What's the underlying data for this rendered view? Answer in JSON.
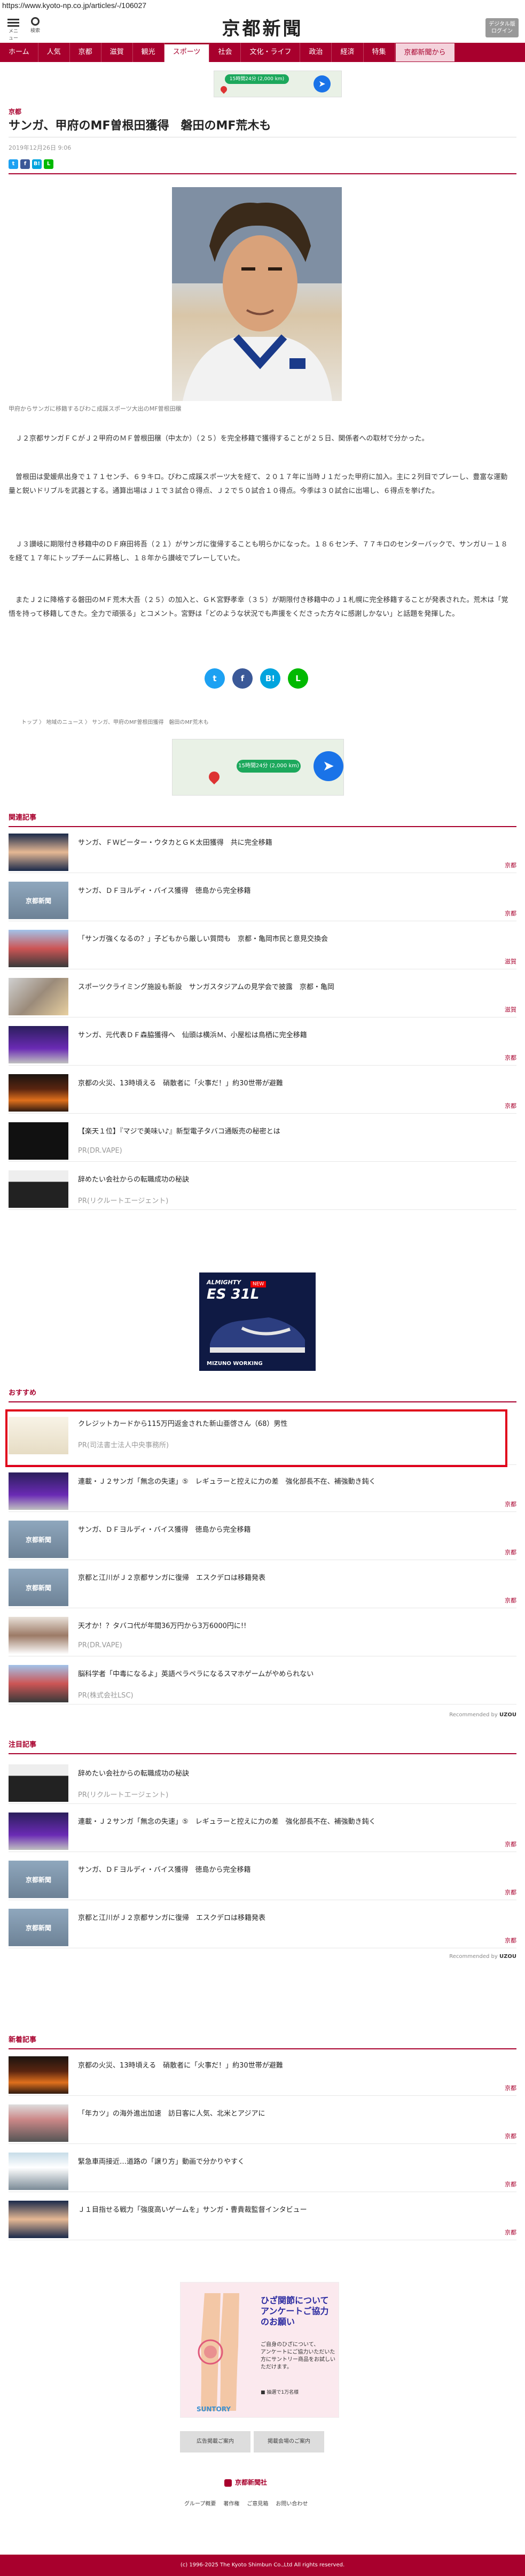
{
  "url": "https://www.kyoto-np.co.jp/articles/-/106027",
  "header": {
    "menu_label": "メニュー",
    "search_label": "検索",
    "logo": "京都新聞",
    "digital_button": "デジタル版\nログイン"
  },
  "nav": [
    "ホーム",
    "人気",
    "京都",
    "滋賀",
    "観光",
    "スポーツ",
    "社会",
    "文化・ライフ",
    "政治",
    "経済",
    "特集",
    "京都新聞から"
  ],
  "ad_top": {
    "text": "15時間24分 (2,000 km)"
  },
  "article": {
    "section": "京都",
    "title": "サンガ、甲府のMF曽根田獲得　磐田のMF荒木も",
    "date": "2019年12月26日 9:06",
    "caption": "甲府からサンガに移籍するびわこ成蹊スポーツ大出のMF曽根田穣",
    "paragraphs": [
      "　Ｊ２京都サンガＦＣがＪ２甲府のＭＦ曽根田穣（中太か）（２５）を完全移籍で獲得することが２５日、関係者への取材で分かった。",
      "　曽根田は愛媛県出身で１７１センチ、６９キロ。びわこ成蹊スポーツ大を経て、２０１７年に当時Ｊ１だった甲府に加入。主に２列目でプレーし、豊富な運動量と鋭いドリブルを武器とする。通算出場はＪ１で３試合０得点、Ｊ２で５０試合１０得点。今季は３０試合に出場し、６得点を挙げた。",
      "　Ｊ３讃岐に期限付き移籍中のＤＦ麻田将吾（２１）がサンガに復帰することも明らかになった。１８６センチ、７７キロのセンターバックで、サンガＵ－１８を経て１７年にトップチームに昇格し、１８年から讃岐でプレーしていた。",
      "　またＪ２に降格する磐田のＭＦ荒木大吾（２５）の加入と、ＧＫ宮野孝幸（３５）が期限付き移籍中のＪ１札幌に完全移籍することが発表された。荒木は「覚悟を持って移籍してきた。全力で頑張る」とコメント。宮野は「どのような状況でも声援をくださった方々に感謝しかない」と話題を発揮した。"
    ],
    "share": [
      "t",
      "f",
      "B!",
      "L"
    ]
  },
  "breadcrumb": [
    "トップ",
    "地域のニュース",
    "サンガ、甲府のMF曽根田獲得　磐田のMF荒木も"
  ],
  "ad_mid": {
    "text": "15時間24分 (2,000 km)"
  },
  "related": {
    "heading": "関連記事",
    "items": [
      {
        "title": "サンガ、ＦＷピーター・ウタカとＧＫ太田獲得　共に完全移籍",
        "cat": "京都"
      },
      {
        "title": "サンガ、ＤＦヨルディ・バイス獲得　徳島から完全移籍",
        "cat": "京都"
      },
      {
        "title": "「サンガ強くなるの？」子どもから厳しい質問も　京都・亀岡市民と意見交換会",
        "cat": "滋賀"
      },
      {
        "title": "スポーツクライミング施設も新設　サンガスタジアムの見学会で披露　京都・亀岡",
        "cat": "滋賀"
      },
      {
        "title": "サンガ、元代表ＤＦ森脇獲得へ　仙頭は横浜Ｍ、小屋松は鳥栖に完全移籍",
        "cat": "京都"
      },
      {
        "title": "京都の火災、13時頃える　硝散者に「火事だ！」約30世帯が避難",
        "cat": "京都"
      }
    ],
    "ads": [
      {
        "title": "【楽天１位】『マジで美味い♪』新型電子タバコ通販売の秘密とは",
        "pr": "PR(DR.VAPE)"
      },
      {
        "title": "辞めたい会社からの転職成功の秘訣",
        "pr": "PR(リクルートエージェント)"
      }
    ]
  },
  "shoe_ad": {
    "brand": "ALMIGHTY",
    "model": "ES 31L",
    "tag": "NEW",
    "footer": "MIZUNO WORKING"
  },
  "recommend": {
    "heading": "おすすめ",
    "items": [
      {
        "title": "クレジットカードから115万円返金された新山亜啓さん（68）男性",
        "pr": "PR(司法書士法人中央事務所)"
      },
      {
        "title": "連載・Ｊ２サンガ「無念の失速」⑤　レギュラーと控えに力の差　強化部長不在、補強動き鈍く",
        "cat": "京都"
      },
      {
        "title": "サンガ、ＤＦヨルディ・バイス獲得　徳島から完全移籍",
        "cat": "京都"
      },
      {
        "title": "京都と江川がＪ２京都サンガに復帰　エスクデロは移籍発表",
        "cat": "京都"
      },
      {
        "title": "天才か！？タバコ代が年間36万円から3万6000円に!!",
        "pr": "PR(DR.VAPE)"
      },
      {
        "title": "脳科学者「中毒になるよ」英語ペラペラになるスマホゲームがやめられない",
        "pr": "PR(株式会社LSC)"
      }
    ],
    "credit": "Recommended by"
  },
  "attention": {
    "heading": "注目記事",
    "items": [
      {
        "title": "辞めたい会社からの転職成功の秘訣",
        "pr": "PR(リクルートエージェント)"
      },
      {
        "title": "連載・Ｊ２サンガ「無念の失速」⑤　レギュラーと控えに力の差　強化部長不在、補強動き鈍く",
        "cat": "京都"
      },
      {
        "title": "サンガ、ＤＦヨルディ・バイス獲得　徳島から完全移籍",
        "cat": "京都"
      },
      {
        "title": "京都と江川がＪ２京都サンガに復帰　エスクデロは移籍発表",
        "cat": "京都"
      }
    ],
    "credit": "Recommended by"
  },
  "latest": {
    "heading": "新着記事",
    "items": [
      {
        "title": "京都の火災、13時頃える　硝散者に「火事だ！」約30世帯が避難",
        "cat": "京都"
      },
      {
        "title": "「年カツ」の海外進出加速　訪日客に人気、北米とアジアに",
        "cat": "京都"
      },
      {
        "title": "緊急車両接近…道路の「譲り方」動画で分かりやすく",
        "cat": "京都"
      },
      {
        "title": "Ｊ１目指せる戦力「強度高いゲームを」サンガ・曹貴裁監督インタビュー",
        "cat": "京都"
      }
    ]
  },
  "knee_ad": {
    "title": "ひざ関節についてアンケートご協力のお願い",
    "body": "ご自身のひざについて、\nアンケートにご協力いただいた方にサントリー商品をお試しいただけます。",
    "note": "■ 抽選で1万名様",
    "brand": "SUNTORY"
  },
  "buttons": [
    "広告掲載ご案内",
    "掲載会場のご案内"
  ],
  "footer": {
    "logo": "京都新聞社",
    "links": [
      "グループ概要",
      "著作権",
      "ご意見箱",
      "お問い合わせ"
    ],
    "copyright": "(c) 1996-2025 The Kyoto Shimbun Co.,Ltd All rights reserved."
  }
}
